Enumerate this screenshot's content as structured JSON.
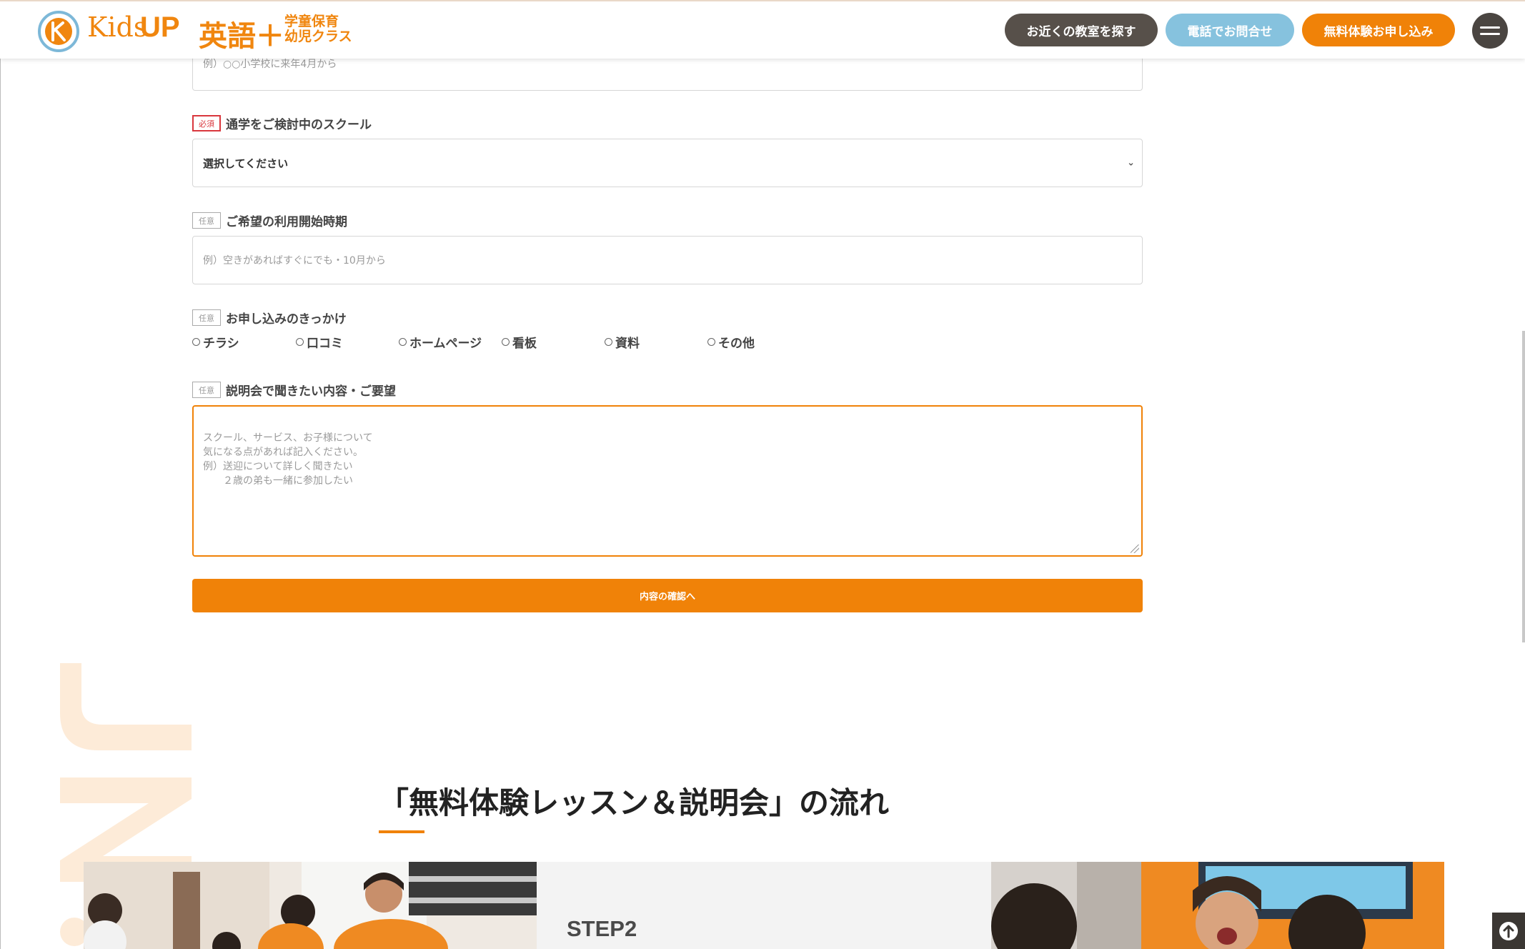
{
  "header": {
    "logo_text": "Kids",
    "logo_up": "UP",
    "logo_eigo": "英語＋",
    "logo_sub_line1": "学童保育",
    "logo_sub_line2": "幼児クラス",
    "btn_find": "お近くの教室を探す",
    "btn_phone": "電話でお問合せ",
    "btn_trial": "無料体験お申し込み"
  },
  "form": {
    "prev_field_placeholder": "例）○○小学校に来年4月から",
    "school": {
      "tag": "必須",
      "label": "通学をご検討中のスクール",
      "selected": "選択してください"
    },
    "start_time": {
      "tag": "任意",
      "label": "ご希望の利用開始時期",
      "placeholder": "例）空きがあればすぐにでも・10月から"
    },
    "trigger": {
      "tag": "任意",
      "label": "お申し込みのきっかけ",
      "options": [
        "チラシ",
        "口コミ",
        "ホームページ",
        "看板",
        "資料",
        "その他"
      ]
    },
    "request": {
      "tag": "任意",
      "label": "説明会で聞きたい内容・ご要望",
      "placeholder": "スクール、サービス、お子様について\n気になる点があれば記入ください。\n例）送迎について詳しく聞きたい\n　　２歳の弟も一緒に参加したい"
    },
    "submit_label": "内容の確認へ"
  },
  "flow": {
    "title": "「無料体験レッスン＆説明会」の流れ",
    "step_label": "STEP2"
  },
  "colors": {
    "accent": "#f08208",
    "dark_button": "#57504a",
    "blue_button": "#86c2de",
    "required": "#d9373d"
  },
  "icons": {
    "menu": "hamburger-icon",
    "scroll_top": "arrow-up-circle-icon",
    "select": "chevron-down-icon"
  }
}
